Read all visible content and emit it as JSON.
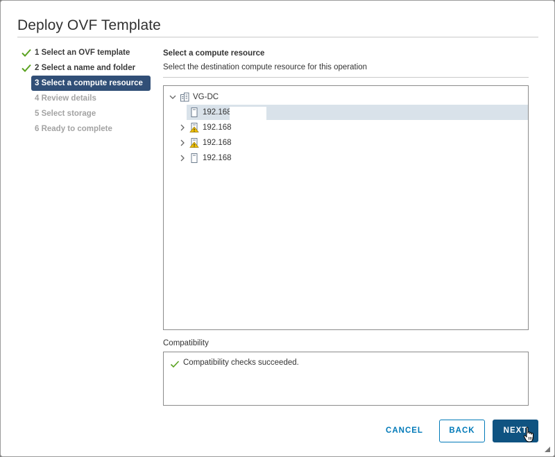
{
  "dialog": {
    "title": "Deploy OVF Template"
  },
  "steps": [
    {
      "label": "1 Select an OVF template",
      "state": "done"
    },
    {
      "label": "2 Select a name and folder",
      "state": "done"
    },
    {
      "label": "3 Select a compute resource",
      "state": "active"
    },
    {
      "label": "4 Review details",
      "state": "pending"
    },
    {
      "label": "5 Select storage",
      "state": "pending"
    },
    {
      "label": "6 Ready to complete",
      "state": "pending"
    }
  ],
  "panel": {
    "heading": "Select a compute resource",
    "subheading": "Select the destination compute resource for this operation"
  },
  "tree": {
    "root": {
      "label": "VG-DC",
      "icon": "datacenter-icon",
      "expanded": true
    },
    "hosts": [
      {
        "label": "192.168",
        "icon": "host-icon",
        "selected": true,
        "warning": false
      },
      {
        "label": "192.168",
        "icon": "host-warning-icon",
        "selected": false,
        "warning": true
      },
      {
        "label": "192.168",
        "icon": "host-warning-icon",
        "selected": false,
        "warning": true
      },
      {
        "label": "192.168",
        "icon": "host-icon",
        "selected": false,
        "warning": false
      }
    ]
  },
  "compatibility": {
    "label": "Compatibility",
    "message": "Compatibility checks succeeded.",
    "status": "success"
  },
  "footer": {
    "cancel_label": "CANCEL",
    "back_label": "BACK",
    "next_label": "NEXT"
  },
  "colors": {
    "accent": "#0079b8",
    "primary_button": "#0f5381",
    "active_step": "#314f77",
    "success": "#5aa220",
    "warning": "#f2c200",
    "selected_row": "#d9e2ea"
  }
}
